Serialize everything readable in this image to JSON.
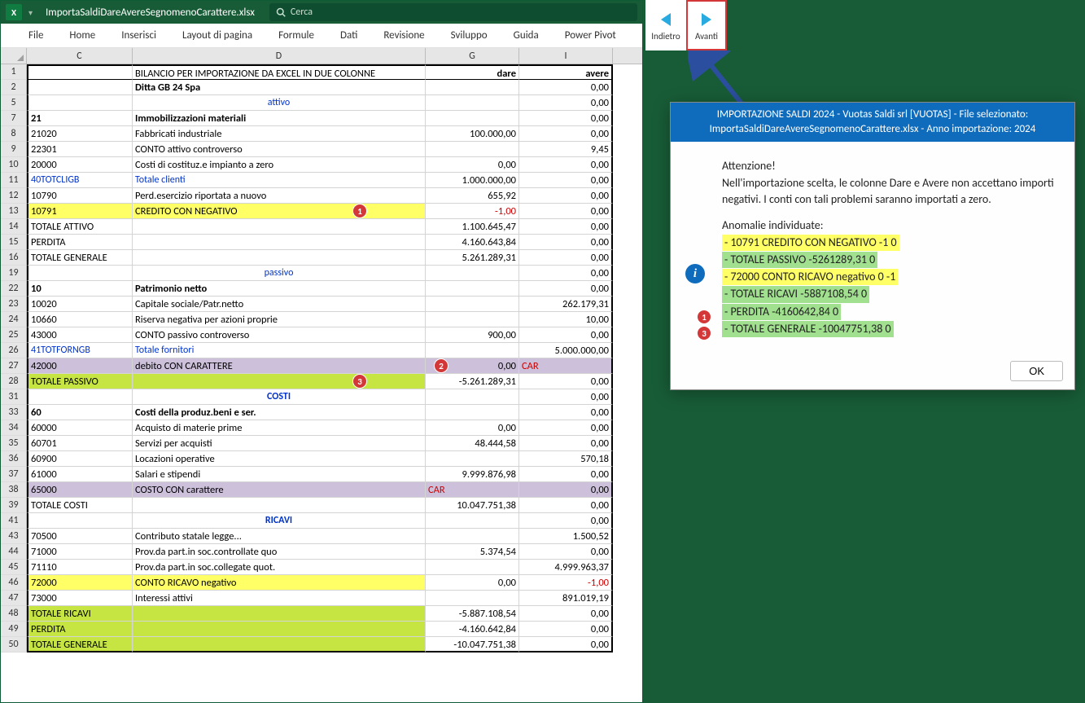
{
  "filename": "ImportaSaldiDareAvereSegnomenoCarattere.xlsx",
  "search_placeholder": "Cerca",
  "ribbon": [
    "File",
    "Home",
    "Inserisci",
    "Layout di pagina",
    "Formule",
    "Dati",
    "Revisione",
    "Sviluppo",
    "Guida",
    "Power Pivot"
  ],
  "cols": {
    "C": "C",
    "D": "D",
    "G": "G",
    "I": "I"
  },
  "header_row": {
    "D": "BILANCIO PER IMPORTAZIONE DA EXCEL IN DUE COLONNE",
    "G": "dare",
    "I": "avere"
  },
  "rows": [
    {
      "n": "1"
    },
    {
      "n": "2",
      "C": "",
      "D": "Ditta GB 24 Spa",
      "I": "0,00",
      "bold": true
    },
    {
      "n": "5",
      "D": "attivo",
      "I": "0,00",
      "center": true,
      "blue": true
    },
    {
      "n": "7",
      "C": "21",
      "D": "Immobilizzazioni materiali",
      "I": "0,00",
      "bold": true
    },
    {
      "n": "8",
      "C": "21020",
      "D": "Fabbricati industriale",
      "G": "100.000,00",
      "I": "0,00"
    },
    {
      "n": "9",
      "C": "22301",
      "D": "CONTO attivo controverso",
      "I": "9,45"
    },
    {
      "n": "10",
      "C": "20000",
      "D": "Costi di costituz.e impianto a zero",
      "G": "0,00",
      "I": "0,00"
    },
    {
      "n": "11",
      "C": "40TOTCLIGB",
      "D": "Totale clienti",
      "G": "1.000.000,00",
      "I": "0,00",
      "blue": true
    },
    {
      "n": "12",
      "C": "10790",
      "D": "Perd.esercizio riportata a nuovo",
      "G": "655,92",
      "I": "0,00"
    },
    {
      "n": "13",
      "C": "10791",
      "D": "CREDITO CON NEGATIVO",
      "G": "-1,00",
      "I": "0,00",
      "hl": "yellow",
      "redG": true,
      "annot": "1"
    },
    {
      "n": "14",
      "C": "TOTALE ATTIVO",
      "G": "1.100.645,47",
      "I": "0,00"
    },
    {
      "n": "15",
      "C": "PERDITA",
      "G": "4.160.643,84",
      "I": "0,00"
    },
    {
      "n": "16",
      "C": "TOTALE GENERALE",
      "G": "5.261.289,31",
      "I": "0,00"
    },
    {
      "n": "19",
      "D": "passivo",
      "I": "0,00",
      "center": true,
      "blue": true
    },
    {
      "n": "22",
      "C": "10",
      "D": "Patrimonio netto",
      "I": "0,00",
      "bold": true
    },
    {
      "n": "23",
      "C": "10020",
      "D": "Capitale sociale/Patr.netto",
      "I": "262.179,31"
    },
    {
      "n": "24",
      "C": "10660",
      "D": "Riserva negativa per azioni proprie",
      "I": "10,00"
    },
    {
      "n": "25",
      "C": "43000",
      "D": "CONTO passivo controverso",
      "G": "900,00",
      "I": "0,00"
    },
    {
      "n": "26",
      "C": "41TOTFORNGB",
      "D": "Totale fornitori",
      "I": "5.000.000,00",
      "blue": true
    },
    {
      "n": "27",
      "C": "42000",
      "D": "debito CON CARATTERE",
      "G": "0,00",
      "I": "CAR",
      "hl": "lilac",
      "annot": "2",
      "redI": true,
      "Ileft": true
    },
    {
      "n": "28",
      "C": "TOTALE PASSIVO",
      "G": "-5.261.289,31",
      "I": "0,00",
      "hl": "lime",
      "annot": "3"
    },
    {
      "n": "31",
      "D": "COSTI",
      "I": "0,00",
      "center": true,
      "blue": true,
      "bold": true
    },
    {
      "n": "33",
      "C": "60",
      "D": "Costi della produz.beni e ser.",
      "I": "0,00",
      "bold": true
    },
    {
      "n": "34",
      "C": "60000",
      "D": "Acquisto di materie prime",
      "G": "0,00",
      "I": "0,00"
    },
    {
      "n": "35",
      "C": "60701",
      "D": "Servizi per acquisti",
      "G": "48.444,58",
      "I": "0,00"
    },
    {
      "n": "36",
      "C": "60900",
      "D": "Locazioni operative",
      "I": "570,18"
    },
    {
      "n": "37",
      "C": "61000",
      "D": "Salari e stipendi",
      "G": "9.999.876,98",
      "I": "0,00"
    },
    {
      "n": "38",
      "C": "65000",
      "D": "COSTO CON carattere",
      "G": "CAR",
      "I": "0,00",
      "hl": "lilac",
      "redG": true,
      "Gleft": true
    },
    {
      "n": "39",
      "C": "TOTALE COSTI",
      "G": "10.047.751,38",
      "I": "0,00"
    },
    {
      "n": "41",
      "D": "RICAVI",
      "I": "0,00",
      "center": true,
      "blue": true,
      "bold": true
    },
    {
      "n": "43",
      "C": "70500",
      "D": "Contributo statale legge...",
      "I": "1.500,52"
    },
    {
      "n": "44",
      "C": "71000",
      "D": "Prov.da part.in soc.controllate quo",
      "G": "5.374,54",
      "I": "0,00"
    },
    {
      "n": "45",
      "C": "71110",
      "D": "Prov.da part.in soc.collegate quot.",
      "I": "4.999.963,37"
    },
    {
      "n": "46",
      "C": "72000",
      "D": "CONTO RICAVO negativo",
      "G": "0,00",
      "I": "-1,00",
      "hl": "yellow",
      "redI": true
    },
    {
      "n": "47",
      "C": "73000",
      "D": "Interessi attivi",
      "I": "891.019,19"
    },
    {
      "n": "48",
      "C": "TOTALE RICAVI",
      "G": "-5.887.108,54",
      "I": "0,00",
      "hl": "lime"
    },
    {
      "n": "49",
      "C": "PERDITA",
      "G": "-4.160.642,84",
      "I": "0,00",
      "hl": "lime"
    },
    {
      "n": "50",
      "C": "TOTALE GENERALE",
      "G": "-10.047.751,38",
      "I": "0,00",
      "hl": "lime",
      "last": true
    }
  ],
  "nav": {
    "back": "Indietro",
    "forward": "Avanti"
  },
  "dialog": {
    "title1": "IMPORTAZIONE SALDI 2024 - Vuotas Saldi srl [VUOTAS] - File selezionato:",
    "title2": "ImportaSaldiDareAvereSegnomenoCarattere.xlsx - Anno importazione: 2024",
    "att": "Attenzione!",
    "body": "Nell'importazione scelta, le colonne Dare e Avere non accettano importi negativi. I conti con tali problemi saranno importati a zero.",
    "an_label": "Anomalie individuate:",
    "anomalies": [
      {
        "t": "- 10791 CREDITO CON NEGATIVO -1 0",
        "hl": "y",
        "ann": "1"
      },
      {
        "t": "- TOTALE PASSIVO -5261289,31 0",
        "hl": "g",
        "ann": "3"
      },
      {
        "t": "- 72000 CONTO RICAVO negativo 0 -1",
        "hl": "y"
      },
      {
        "t": "- TOTALE RICAVI -5887108,54 0",
        "hl": "g"
      },
      {
        "t": "- PERDITA -4160642,84 0",
        "hl": "g"
      },
      {
        "t": "- TOTALE GENERALE -10047751,38 0",
        "hl": "g"
      }
    ],
    "ok": "OK"
  }
}
